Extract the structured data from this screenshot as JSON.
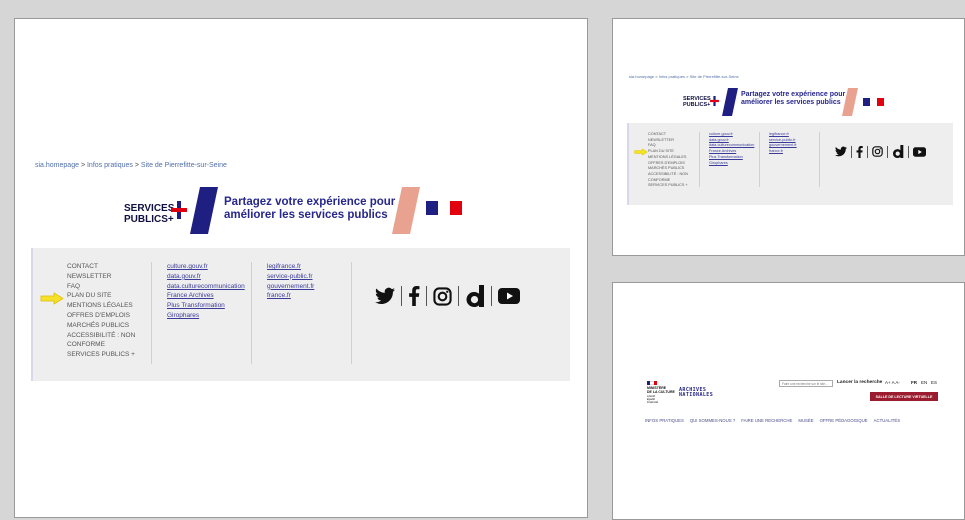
{
  "breadcrumb": {
    "home": "sia.homepage",
    "sep": ">",
    "level1": "Infos pratiques",
    "level2": "Site de Pierrefitte-sur-Seine"
  },
  "banner": {
    "logo_line1": "SERVICES",
    "logo_line2": "PUBLICS+",
    "text_line1": "Partagez votre expérience pour",
    "text_line2": "améliorer les services publics"
  },
  "footer": {
    "nav_items": [
      "CONTACT",
      "NEWSLETTER",
      "FAQ",
      "PLAN DU SITE",
      "MENTIONS LÉGALES",
      "OFFRES D'EMPLOIS",
      "MARCHÉS PUBLICS",
      "ACCESSIBILITÉ : NON",
      "CONFORME",
      "SERVICES PUBLICS +"
    ],
    "links_col1": [
      "culture.gouv.fr",
      "data.gouv.fr",
      "data.culturecommunication",
      "France Archives",
      "Plus Transformation",
      "Girophares"
    ],
    "links_col2": [
      "legifrance.fr",
      "service-public.fr",
      "gouvernement.fr",
      "france.fr"
    ],
    "social_icons": [
      "twitter-icon",
      "facebook-icon",
      "instagram-icon",
      "dailymotion-icon",
      "youtube-icon"
    ],
    "arrow_color": "#f5e02a"
  },
  "header": {
    "ministry_line1": "MINISTÈRE",
    "ministry_line2": "DE LA CULTURE",
    "ministry_sub1": "Liberté",
    "ministry_sub2": "Égalité",
    "ministry_sub3": "Fraternité",
    "archives_line1": "ARCHIVES",
    "archives_line2": "NATIONALES",
    "search_placeholder": "Faire une recherche sur le site...",
    "search_button": "Lancer la recherche",
    "font_controls": "A+ A A-",
    "lang1": "FR",
    "lang2": "EN",
    "lang3": "ES",
    "reading_room": "SALLE DE LECTURE VIRTUELLE",
    "nav": [
      "INFOS PRATIQUES",
      "QUI SOMMES-NOUS ?",
      "FAIRE UNE RECHERCHE",
      "MUSÉE",
      "OFFRE PÉDAGOGIQUE",
      "ACTUALITÉS"
    ]
  },
  "colors": {
    "accent_blue": "#1f1f82",
    "accent_red": "#e8a28f",
    "footer_bg": "#eeeeee",
    "reading_room_btn": "#9b1c2e"
  }
}
